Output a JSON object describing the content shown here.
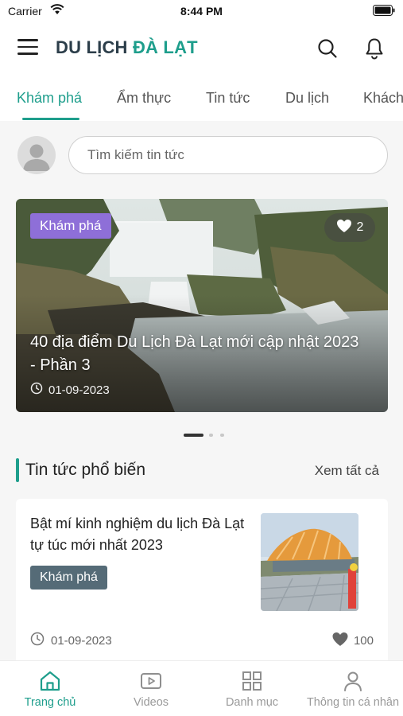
{
  "status_bar": {
    "carrier": "Carrier",
    "time": "8:44 PM"
  },
  "header": {
    "title_part1": "DU LỊCH",
    "title_part2": "ĐÀ LẠT"
  },
  "tabs": [
    {
      "label": "Khám phá",
      "active": true
    },
    {
      "label": "Ẩm thực"
    },
    {
      "label": "Tin tức"
    },
    {
      "label": "Du lịch"
    },
    {
      "label": "Khách"
    }
  ],
  "search": {
    "placeholder": "Tìm kiếm tin tức",
    "value": ""
  },
  "featured": {
    "tag": "Khám phá",
    "likes": "2",
    "title": "40 địa điểm Du Lịch Đà Lạt mới cập nhật 2023 - Phần 3",
    "date": "01-09-2023",
    "active_slide": 1,
    "slide_count": 3
  },
  "section": {
    "title": "Tin tức phổ biến",
    "see_all": "Xem tất cả"
  },
  "news": [
    {
      "title": "Bật mí kinh nghiệm du lịch Đà Lạt tự túc mới nhất 2023",
      "tag": "Khám phá",
      "date": "01-09-2023",
      "likes": "100"
    }
  ],
  "bottom_nav": [
    {
      "label": "Trang chủ",
      "icon": "home-icon",
      "active": true
    },
    {
      "label": "Videos",
      "icon": "video-icon"
    },
    {
      "label": "Danh mục",
      "icon": "grid-icon"
    },
    {
      "label": "Thông tin cá nhân",
      "icon": "user-icon"
    }
  ],
  "colors": {
    "accent": "#1e9e8c",
    "tag_purple": "#8e6fd8",
    "tag_slate": "#556b77"
  }
}
